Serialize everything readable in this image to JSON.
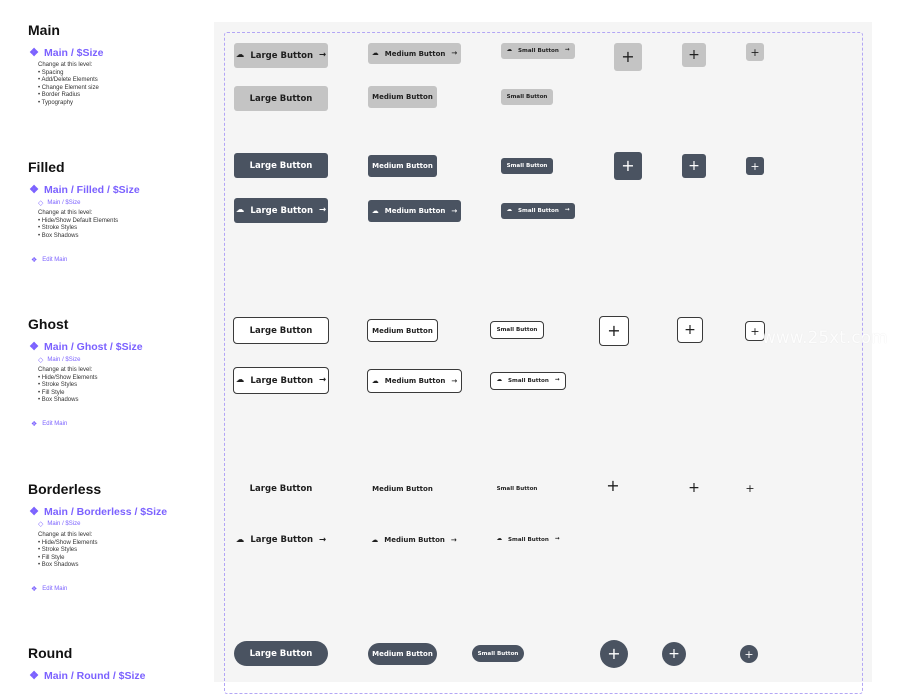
{
  "sections": {
    "main": {
      "title": "Main",
      "component": "Main / $Size",
      "note_heading": "Change at this level:",
      "items": [
        "Spacing",
        "Add/Delete Elements",
        "Change Element size",
        "Border Radius",
        "Typography"
      ]
    },
    "filled": {
      "title": "Filled",
      "component": "Main / Filled / $Size",
      "sub": "Main / $Size",
      "note_heading": "Change at this level:",
      "items": [
        "Hide/Show Default Elements",
        "Stroke Styles",
        "Box Shadows"
      ],
      "edit": "Edit Main"
    },
    "ghost": {
      "title": "Ghost",
      "component": "Main / Ghost / $Size",
      "sub": "Main / $Size",
      "note_heading": "Change at this level:",
      "items": [
        "Hide/Show Elements",
        "Stroke Styles",
        "Fill Style",
        "Box Shadows"
      ],
      "edit": "Edit Main"
    },
    "borderless": {
      "title": "Borderless",
      "component": "Main / Borderless / $Size",
      "sub": "Main / $Size",
      "note_heading": "Change at this level:",
      "items": [
        "Hide/Show Elements",
        "Stroke Styles",
        "Fill Style",
        "Box Shadows"
      ],
      "edit": "Edit Main"
    },
    "round": {
      "title": "Round",
      "component": "Main / Round / $Size"
    }
  },
  "buttons": {
    "large": "Large Button",
    "medium": "Medium Button",
    "small": "Small Button"
  },
  "icons": {
    "leading": "cloud-icon",
    "trailing": "arrow-right-icon",
    "icon_only": "plus-icon",
    "component": "component-diamond-icon"
  },
  "watermark": "www.25xt.com",
  "colors": {
    "accent": "#7b61ff",
    "filled": "#4a5361",
    "disabled": "#c4c4c4",
    "canvas": "#f5f5f5"
  }
}
